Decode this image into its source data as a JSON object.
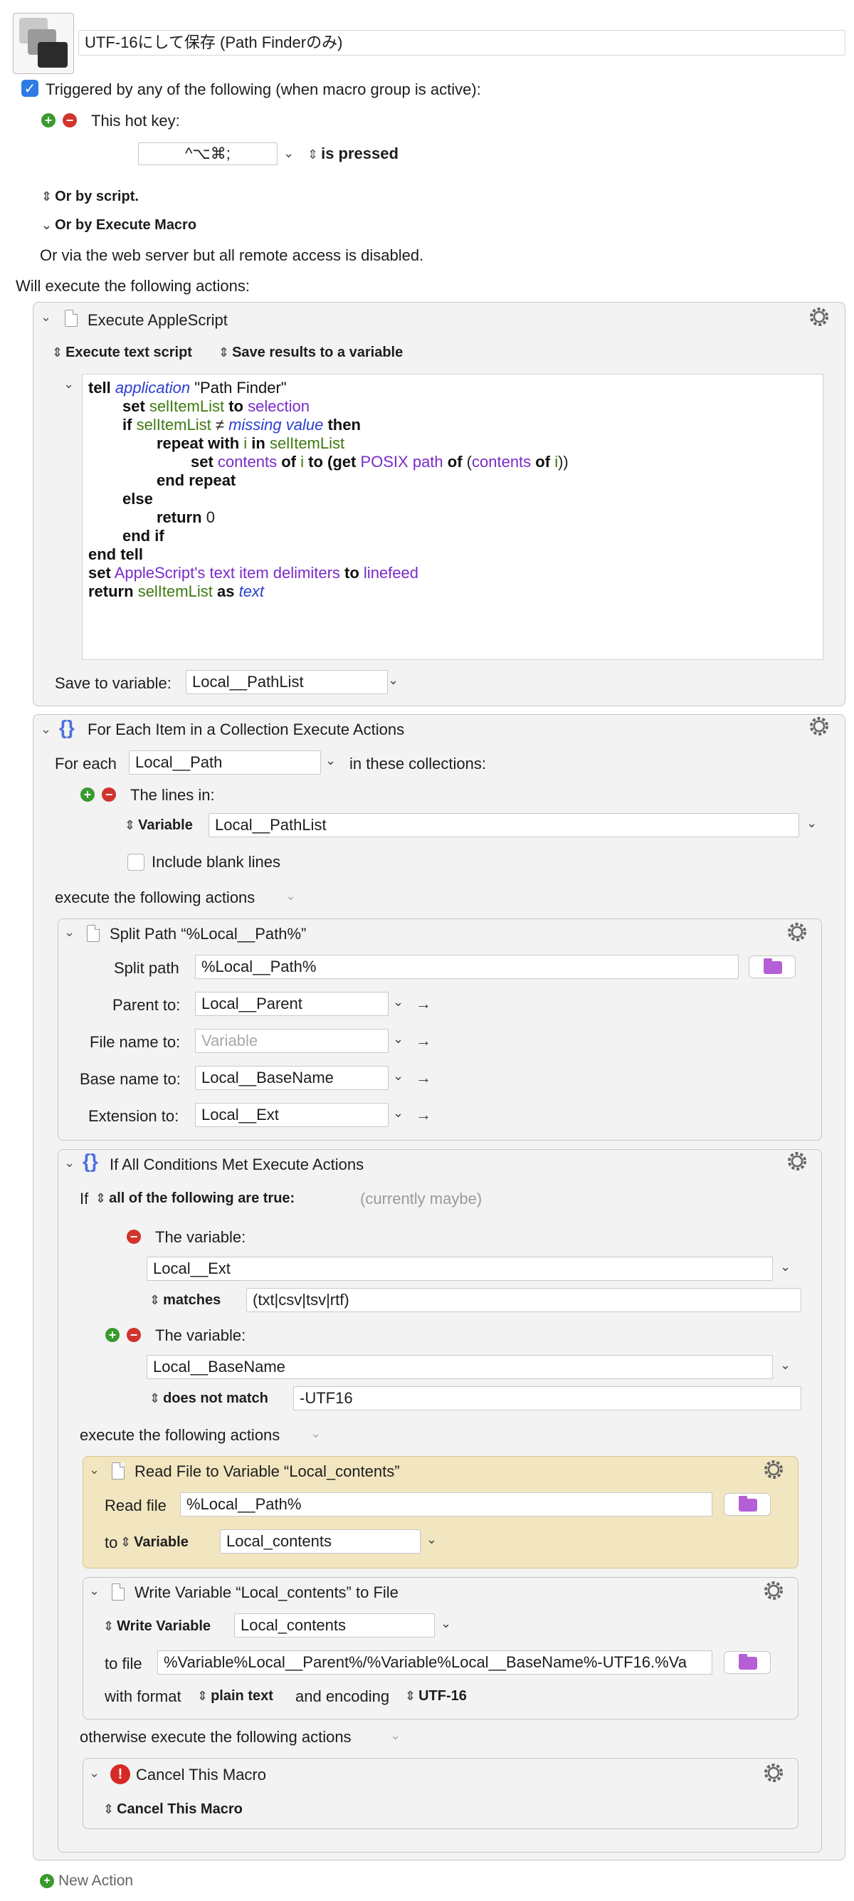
{
  "header": {
    "macro_name": "UTF-16にして保存 (Path Finderのみ)",
    "triggered_label": "Triggered by any of the following (when macro group is active):",
    "hotkey_label": "This hot key:",
    "hotkey_value": "^⌥⌘;",
    "hotkey_state": "is pressed",
    "or_by_script": "Or by script.",
    "or_by_execute_macro": "Or by Execute Macro",
    "web_server_note": "Or via the web server but all remote access is disabled.",
    "will_execute": "Will execute the following actions:"
  },
  "applescript": {
    "title": "Execute AppleScript",
    "mode": "Execute text script",
    "save_mode": "Save results to a variable",
    "save_to_label": "Save to variable:",
    "save_to_value": "Local__PathList",
    "lines": {
      "l1": {
        "a": "tell",
        "b": "application",
        "c": "\"Path Finder\""
      },
      "l2": {
        "a": "set",
        "b": "selItemList",
        "c": "to",
        "d": "selection"
      },
      "l3": {
        "a": "if",
        "b": "selItemList",
        "c": "≠",
        "d": "missing value",
        "e": "then"
      },
      "l4": {
        "a": "repeat with",
        "b": "i",
        "c": "in",
        "d": "selItemList"
      },
      "l5": {
        "a": "set",
        "b": "contents",
        "c": "of",
        "d": "i",
        "e": "to",
        "f": "(get",
        "g": "POSIX path",
        "h": "of",
        "i": "(",
        "j": "contents",
        "k": "of",
        "l": "i",
        "m": "))"
      },
      "l6": {
        "a": "end repeat"
      },
      "l7": {
        "a": "else"
      },
      "l8": {
        "a": "return",
        "b": "0"
      },
      "l9": {
        "a": "end if"
      },
      "l10": {
        "a": "end tell"
      },
      "l11": {
        "a": "set",
        "b": "AppleScript's text item delimiters",
        "c": "to",
        "d": "linefeed"
      },
      "l12": {
        "a": "return",
        "b": "selItemList",
        "c": "as",
        "d": "text"
      }
    }
  },
  "foreach": {
    "title": "For Each Item in a Collection Execute Actions",
    "for_each_label": "For each",
    "for_each_value": "Local__Path",
    "in_collections": "in these collections:",
    "lines_in": "The lines in:",
    "variable_label": "Variable",
    "variable_value": "Local__PathList",
    "include_blank": "Include blank lines",
    "execute_following": "execute the following actions"
  },
  "splitpath": {
    "title": "Split Path “%Local__Path%”",
    "split_label": "Split path",
    "split_value": "%Local__Path%",
    "parent_label": "Parent to:",
    "parent_value": "Local__Parent",
    "filename_label": "File name to:",
    "filename_placeholder": "Variable",
    "basename_label": "Base name to:",
    "basename_value": "Local__BaseName",
    "ext_label": "Extension to:",
    "ext_value": "Local__Ext"
  },
  "ifall": {
    "title": "If All Conditions Met Execute Actions",
    "if_label": "If",
    "all_true": "all of the following are true:",
    "currently": "(currently maybe)",
    "the_variable_1": "The variable:",
    "var1_value": "Local__Ext",
    "op1": "matches",
    "op1_value": "(txt|csv|tsv|rtf)",
    "the_variable_2": "The variable:",
    "var2_value": "Local__BaseName",
    "op2": "does not match",
    "op2_value": "-UTF16",
    "execute_following": "execute the following actions",
    "otherwise": "otherwise execute the following actions"
  },
  "readfile": {
    "title": "Read File to Variable “Local_contents”",
    "read_label": "Read file",
    "read_value": "%Local__Path%",
    "to_label": "to",
    "variable_label": "Variable",
    "variable_value": "Local_contents"
  },
  "writevar": {
    "title": "Write Variable “Local_contents” to File",
    "write_label": "Write Variable",
    "write_value": "Local_contents",
    "to_file_label": "to file",
    "to_file_value": "%Variable%Local__Parent%/%Variable%Local__BaseName%-UTF16.%Va",
    "with_format": "with format",
    "format_value": "plain text",
    "and_encoding": "and encoding",
    "encoding_value": "UTF-16"
  },
  "cancel": {
    "title": "Cancel This Macro",
    "option": "Cancel This Macro"
  },
  "footer": {
    "new_action": "New Action"
  }
}
